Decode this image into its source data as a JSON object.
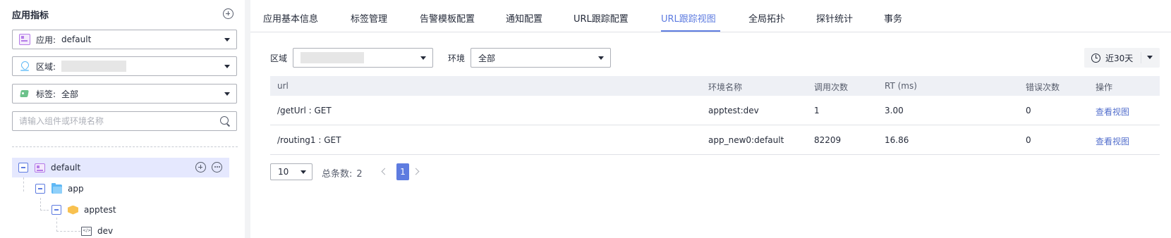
{
  "sidebar": {
    "title": "应用指标",
    "app_select": {
      "label": "应用:",
      "value": "default"
    },
    "region_select": {
      "label": "区域:",
      "value": ""
    },
    "tag_select": {
      "label": "标签:",
      "value": "全部"
    },
    "search": {
      "placeholder": "请输入组件或环境名称"
    },
    "tree": [
      {
        "label": "default",
        "icon": "app-icon",
        "selected": true
      },
      {
        "label": "app",
        "icon": "folder-icon"
      },
      {
        "label": "apptest",
        "icon": "component-icon"
      },
      {
        "label": "dev",
        "icon": "environment-icon"
      }
    ]
  },
  "tabs": [
    {
      "label": "应用基本信息"
    },
    {
      "label": "标签管理"
    },
    {
      "label": "告警模板配置"
    },
    {
      "label": "通知配置"
    },
    {
      "label": "URL跟踪配置"
    },
    {
      "label": "URL跟踪视图",
      "active": true
    },
    {
      "label": "全局拓扑"
    },
    {
      "label": "探针统计"
    },
    {
      "label": "事务"
    }
  ],
  "filters": {
    "region_label": "区域",
    "region_value": "",
    "env_label": "环境",
    "env_value": "全部",
    "time_range": "近30天"
  },
  "table": {
    "columns": [
      "url",
      "环境名称",
      "调用次数",
      "RT (ms)",
      "错误次数",
      "操作"
    ],
    "rows": [
      {
        "url": "/getUrl : GET",
        "env": "apptest:dev",
        "calls": "1",
        "rt": "3.00",
        "errors": "0",
        "action": "查看视图"
      },
      {
        "url": "/routing1 : GET",
        "env": "app_new0:default",
        "calls": "82209",
        "rt": "16.86",
        "errors": "0",
        "action": "查看视图"
      }
    ]
  },
  "pagination": {
    "page_size": "10",
    "total_label": "总条数:",
    "total": "2",
    "current_page": "1"
  },
  "colors": {
    "accent": "#5e7ce0",
    "link": "#526ecc",
    "tree_selected_bg": "#e5e8fe",
    "header_bg": "#eef0f5"
  }
}
